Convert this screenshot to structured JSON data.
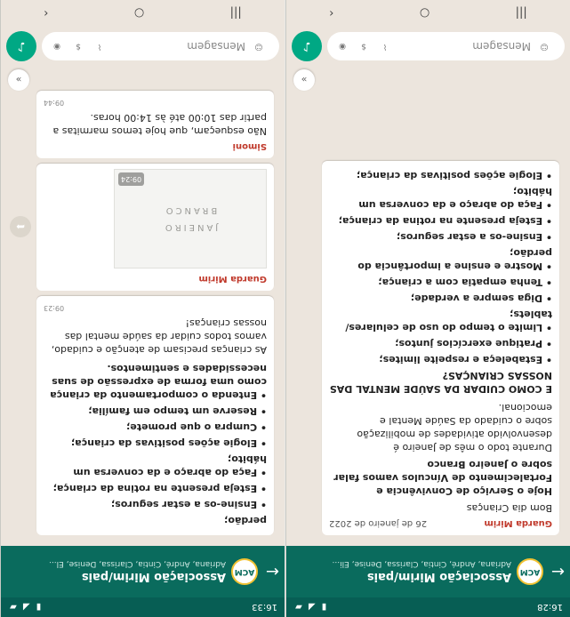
{
  "colors": {
    "header": "#075e54",
    "accent": "#00a884",
    "sender": "#c0392b",
    "chat_bg": "#ece5dd"
  },
  "phoneA": {
    "status_time": "16:28",
    "group_name": "Associação Mirim/pais",
    "members": "Adriana, André, Cintia, Clarissa, Denise, Eli...",
    "msg1": {
      "sender": "Guarda Mirim",
      "date": "26 de janeiro de 2022",
      "greeting": "Bom dia Crianças",
      "intro1": "Hoje o Serviço de Convivência e Fortalecimento de Vínculos vamos falar sobre o Janeiro Branco",
      "intro2": "Durante todo o mês de Janeiro é desenvolvido atividades de mobilização sobre o cuidado da Saúde Mental e emocional.",
      "heading": "E COMO CUIDAR DA SAÚDE MENTAL DAS NOSSAS CRIANÇAS?",
      "bullets": [
        "• Estabeleça e respeite limites;",
        "• Pratique exercícios juntos;",
        "• Limite o tempo do uso de celulares/ tablets;",
        "• Diga sempre a verdade;",
        "• Tenha empatia com a criança;",
        "• Mostre e ensine a importância do perdão;",
        "• Ensine-os a estar seguros;",
        "• Esteja presente na rotina da criança;",
        "• Faça do abraço e da conversa um hábito;",
        "• Elogie ações positivas da criança;"
      ]
    },
    "input_placeholder": "Mensagem",
    "icons": {
      "back": "back-arrow-icon",
      "emoji": "emoji-icon",
      "attach": "paperclip-icon",
      "money": "currency-icon",
      "camera": "camera-icon",
      "mic": "microphone-icon"
    }
  },
  "phoneB": {
    "status_time": "16:33",
    "group_name": "Associação Mirim/pais",
    "members": "Adriana, André, Cintia, Clarissa, Denise, El...",
    "msg1": {
      "bullets": [
        "perdão;",
        "• Ensine-os a estar seguros;",
        "• Esteja presente na rotina da criança;",
        "• Faça do abraço e da conversa um hábito;",
        "• Elogie ações positivas da criança;",
        "• Cumpra o que promete;",
        "• Reserve um tempo em família;",
        "• Entenda o comportamento da criança como uma forma de expressão de suas necessidades e sentimentos."
      ],
      "footer": "As crianças precisam de atenção e cuidado, vamos todos cuidar da saúde mental das nossas crianças!",
      "time": "09:23"
    },
    "msg2": {
      "sender": "Guarda Mirim",
      "img_line1": "JANEIRO",
      "img_line2": "BRANCO",
      "time": "09:24"
    },
    "msg3": {
      "sender": "Simoni",
      "text": "Não esqueçam, que hoje temos marmitas a partir das 10:00 até às 14:00 horas.",
      "time": "09:44"
    },
    "input_placeholder": "Mensagem"
  }
}
